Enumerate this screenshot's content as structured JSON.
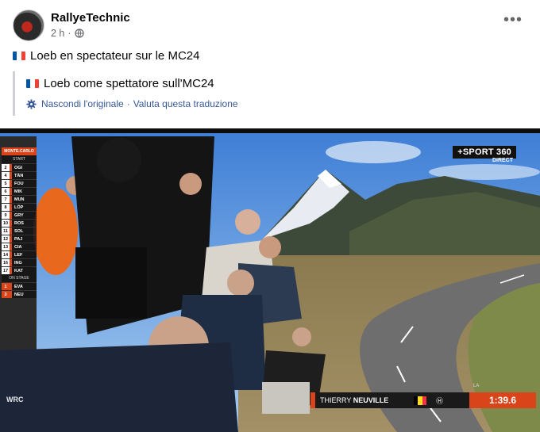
{
  "post": {
    "author": "RallyeTechnic",
    "time": "2 h",
    "separator": "·",
    "text": "Loeb en spectateur sur le MC24",
    "flag_colors": [
      "#0055a4",
      "#ffffff",
      "#ef4135"
    ]
  },
  "translation": {
    "text": "Loeb come spettatore sull'MC24",
    "hide_original": "Nascondi l'originale",
    "dot": "·",
    "rate": "Valuta questa traduzione"
  },
  "video": {
    "standings": {
      "rally": "MONTE-CARLO",
      "start_label": "START",
      "on_stage_label": "ON STAGE",
      "rows": [
        {
          "pos": "2",
          "code": "OGI"
        },
        {
          "pos": "4",
          "code": "TÄN"
        },
        {
          "pos": "5",
          "code": "FOU"
        },
        {
          "pos": "6",
          "code": "MIK"
        },
        {
          "pos": "7",
          "code": "MUN"
        },
        {
          "pos": "8",
          "code": "LÖP"
        },
        {
          "pos": "9",
          "code": "GRY"
        },
        {
          "pos": "10",
          "code": "ROS"
        },
        {
          "pos": "11",
          "code": "SOL"
        },
        {
          "pos": "12",
          "code": "PAJ"
        },
        {
          "pos": "13",
          "code": "CIA"
        },
        {
          "pos": "14",
          "code": "LEF"
        },
        {
          "pos": "16",
          "code": "ING"
        },
        {
          "pos": "17",
          "code": "KAT"
        }
      ],
      "on_stage": [
        {
          "pos": "1",
          "code": "EVA"
        },
        {
          "pos": "3",
          "code": "NEU"
        }
      ]
    },
    "broadcaster": "+SPORT 360",
    "broadcaster_sub": "DIRECT",
    "driver_first": "THIERRY",
    "driver_last": "NEUVILLE",
    "brand": "Ⓗ",
    "time_label": "LA",
    "time": "1:39.6",
    "wrc_logo": "WRC",
    "accent_color": "#d9441a"
  }
}
